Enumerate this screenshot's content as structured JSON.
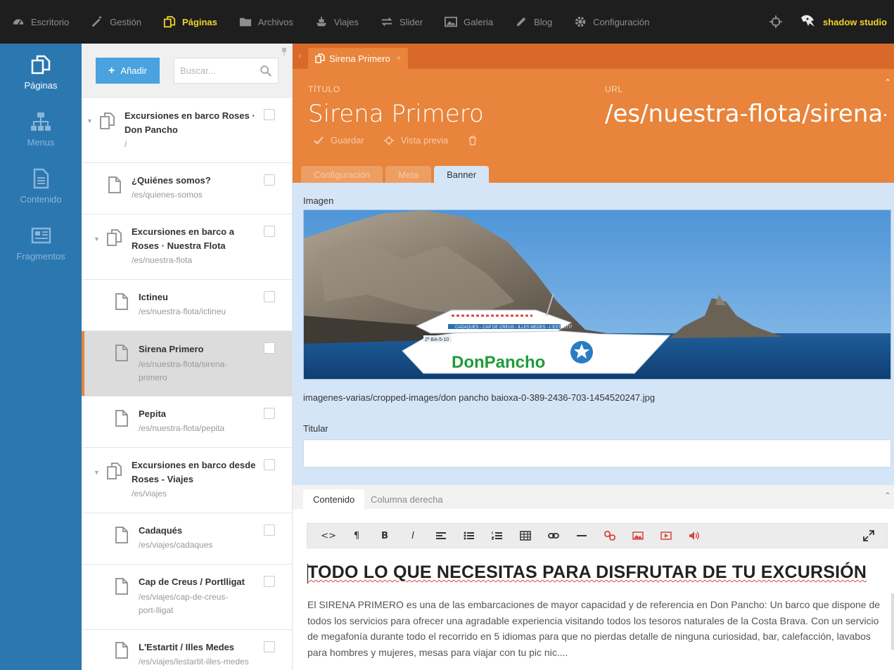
{
  "topnav": {
    "items": [
      {
        "label": "Escritorio",
        "icon": "dashboard-icon"
      },
      {
        "label": "Gestión",
        "icon": "magic-wand-icon"
      },
      {
        "label": "Páginas",
        "icon": "pages-icon",
        "active": true
      },
      {
        "label": "Archivos",
        "icon": "folder-icon"
      },
      {
        "label": "Viajes",
        "icon": "ship-icon"
      },
      {
        "label": "Slider",
        "icon": "exchange-icon"
      },
      {
        "label": "Galeria",
        "icon": "picture-icon"
      },
      {
        "label": "Blog",
        "icon": "pencil-icon"
      },
      {
        "label": "Configuración",
        "icon": "gear-icon"
      }
    ],
    "brand": "shadow studio"
  },
  "sidebar": {
    "items": [
      {
        "label": "Páginas",
        "icon": "pages-icon",
        "active": true
      },
      {
        "label": "Menus",
        "icon": "sitemap-icon"
      },
      {
        "label": "Contenido",
        "icon": "document-icon"
      },
      {
        "label": "Fragmentos",
        "icon": "newspaper-icon"
      }
    ]
  },
  "tree": {
    "add_label": "Añadir",
    "search_placeholder": "Buscar...",
    "nodes": [
      {
        "title": "Excursiones en barco Roses · Don Pancho",
        "url": "/",
        "level": 0,
        "parent": true
      },
      {
        "title": "¿Quiénes somos?",
        "url": "/es/quienes-somos",
        "level": 1
      },
      {
        "title": "Excursiones en barco a Roses · Nuestra Flota",
        "url": "/es/nuestra-flota",
        "level": 1,
        "parent": true
      },
      {
        "title": "Ictineu",
        "url": "/es/nuestra-flota/ictineu",
        "level": 2
      },
      {
        "title": "Sirena Primero",
        "url": "/es/nuestra-flota/sirena-primero",
        "level": 2,
        "selected": true
      },
      {
        "title": "Pepita",
        "url": "/es/nuestra-flota/pepita",
        "level": 2
      },
      {
        "title": "Excursiones en barco desde Roses - Viajes",
        "url": "/es/viajes",
        "level": 1,
        "parent": true
      },
      {
        "title": "Cadaqués",
        "url": "/es/viajes/cadaques",
        "level": 2
      },
      {
        "title": "Cap de Creus / Portlligat",
        "url": "/es/viajes/cap-de-creus-port-lligat",
        "level": 2
      },
      {
        "title": "L'Estartit / Illes Medes",
        "url": "/es/viajes/lestartit-illes-medes",
        "level": 2
      }
    ]
  },
  "editor": {
    "tab_title": "Sirena Primero",
    "label_title": "TÍTULO",
    "label_url": "URL",
    "page_title": "Sirena Primero",
    "page_url": "/es/nuestra-flota/sirena-primero",
    "save_label": "Guardar",
    "preview_label": "Vista previa",
    "subtabs": [
      "Configuración",
      "Meta",
      "Banner"
    ],
    "active_subtab": "Banner",
    "image_label": "Imagen",
    "image_path": "imagenes-varias/cropped-images/don pancho baioxa-0-389-2436-703-1454520247.jpg",
    "boat_name": "DonPancho",
    "boat_stripe": "CADAQUES - CAP DE CREUS - ILLES MEDES - L'ESTARTIT",
    "boat_reg": "2ª BA-5-10",
    "titular_label": "Titular",
    "titular_value": "",
    "content_tabs": [
      "Contenido",
      "Columna derecha"
    ],
    "heading": "TODO LO QUE NECESITAS PARA DISFRUTAR DE TU EXCURSIÓN",
    "paragraph": "El SIRENA PRIMERO es una de las embarcaciones de mayor capacidad y de referencia en Don Pancho: Un barco que dispone de todos los servicios para ofrecer una agradable experiencia visitando todos los tesoros naturales de la Costa Brava. Con un servicio de megafonía durante todo el recorrido en 5 idiomas para que no pierdas detalle de ninguna curiosidad, bar, calefacción, lavabos para hombres y mujeres, mesas para viajar con tu pic nic...."
  },
  "colors": {
    "topbar": "#1e1e1e",
    "active_nav": "#f2d32b",
    "sidebar": "#2b77b0",
    "orange": "#e8843b",
    "panel_blue": "#d4e5f7",
    "add_button": "#4aa3df"
  }
}
